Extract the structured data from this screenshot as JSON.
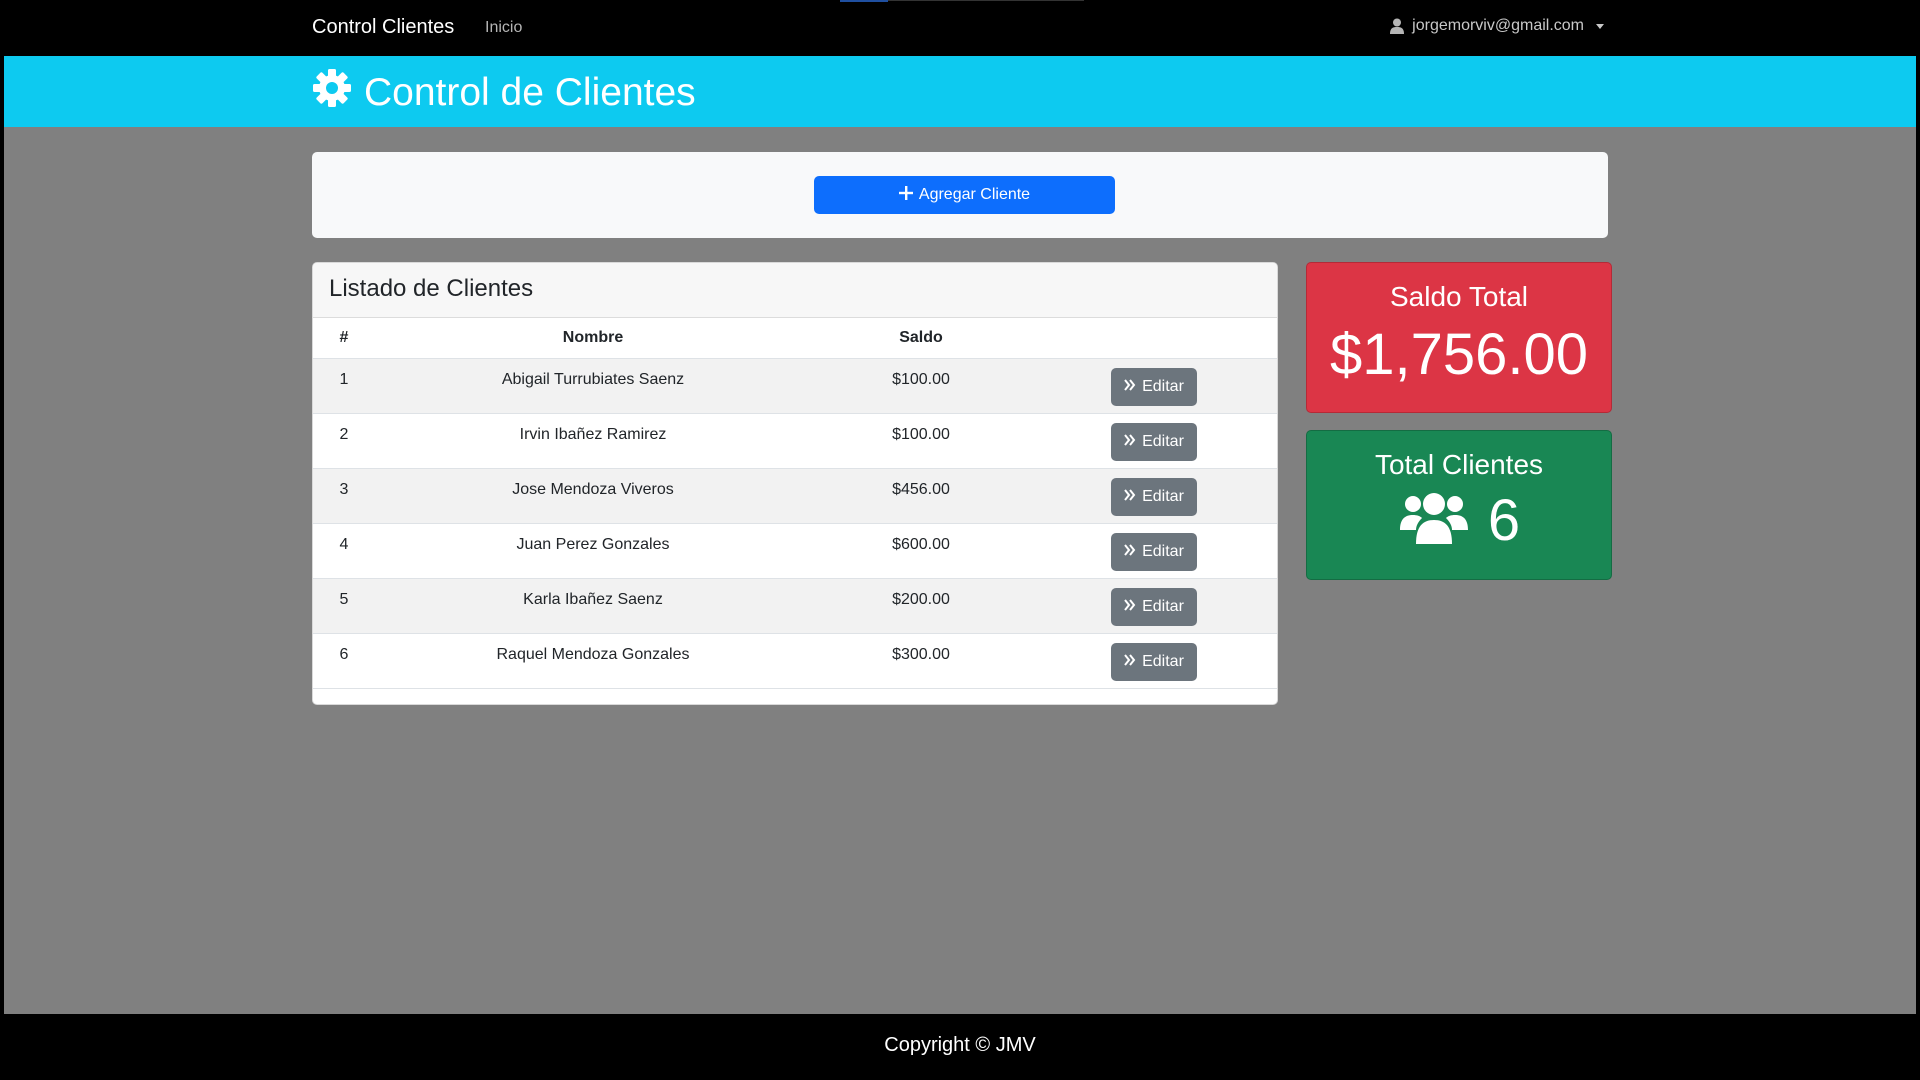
{
  "navbar": {
    "brand": "Control Clientes",
    "link_inicio": "Inicio",
    "user_email": "jorgemorviv@gmail.com"
  },
  "header": {
    "title": "Control de Clientes",
    "icon": "gear-icon"
  },
  "toolbar": {
    "add_label": "Agregar Cliente"
  },
  "list": {
    "title": "Listado de Clientes",
    "columns": [
      "#",
      "Nombre",
      "Saldo",
      ""
    ],
    "rows": [
      {
        "num": "1",
        "nombre": "Abigail Turrubiates Saenz",
        "saldo": "$100.00",
        "action": "Editar"
      },
      {
        "num": "2",
        "nombre": "Irvin Ibañez Ramirez",
        "saldo": "$100.00",
        "action": "Editar"
      },
      {
        "num": "3",
        "nombre": "Jose Mendoza Viveros",
        "saldo": "$456.00",
        "action": "Editar"
      },
      {
        "num": "4",
        "nombre": "Juan Perez Gonzales",
        "saldo": "$600.00",
        "action": "Editar"
      },
      {
        "num": "5",
        "nombre": "Karla Ibañez Saenz",
        "saldo": "$200.00",
        "action": "Editar"
      },
      {
        "num": "6",
        "nombre": "Raquel Mendoza Gonzales",
        "saldo": "$300.00",
        "action": "Editar"
      }
    ]
  },
  "stats": {
    "saldo_title": "Saldo Total",
    "saldo_value": "$1,756.00",
    "clientes_title": "Total Clientes",
    "clientes_value": "6"
  },
  "footer": {
    "text": "Copyright © JMV"
  },
  "colors": {
    "header_bg": "#0dcaf0",
    "primary": "#0d6efd",
    "secondary": "#6c757d",
    "danger": "#dc3545",
    "success": "#198754",
    "page_bg": "#808080"
  }
}
